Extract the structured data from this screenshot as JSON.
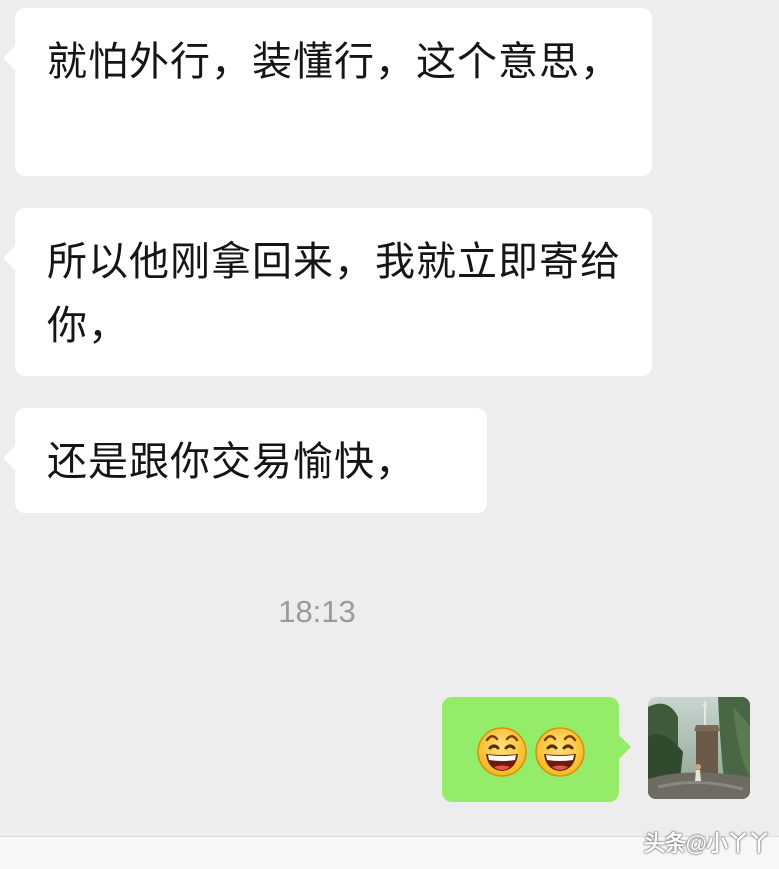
{
  "messages": [
    {
      "direction": "received",
      "text": "就怕外行，装懂行，这个意思，"
    },
    {
      "direction": "received",
      "text": "所以他刚拿回来，我就立即寄给你，"
    },
    {
      "direction": "received",
      "text": "还是跟你交易愉快，"
    }
  ],
  "timestamp": "18:13",
  "sent_message": {
    "direction": "sent",
    "content": [
      "grinning-face-emoji",
      "grinning-face-emoji"
    ]
  },
  "watermark": "头条@小丫丫",
  "colors": {
    "background": "#ededed",
    "received_bubble": "#ffffff",
    "sent_bubble": "#95ec69",
    "timestamp": "#9a9a9a"
  }
}
